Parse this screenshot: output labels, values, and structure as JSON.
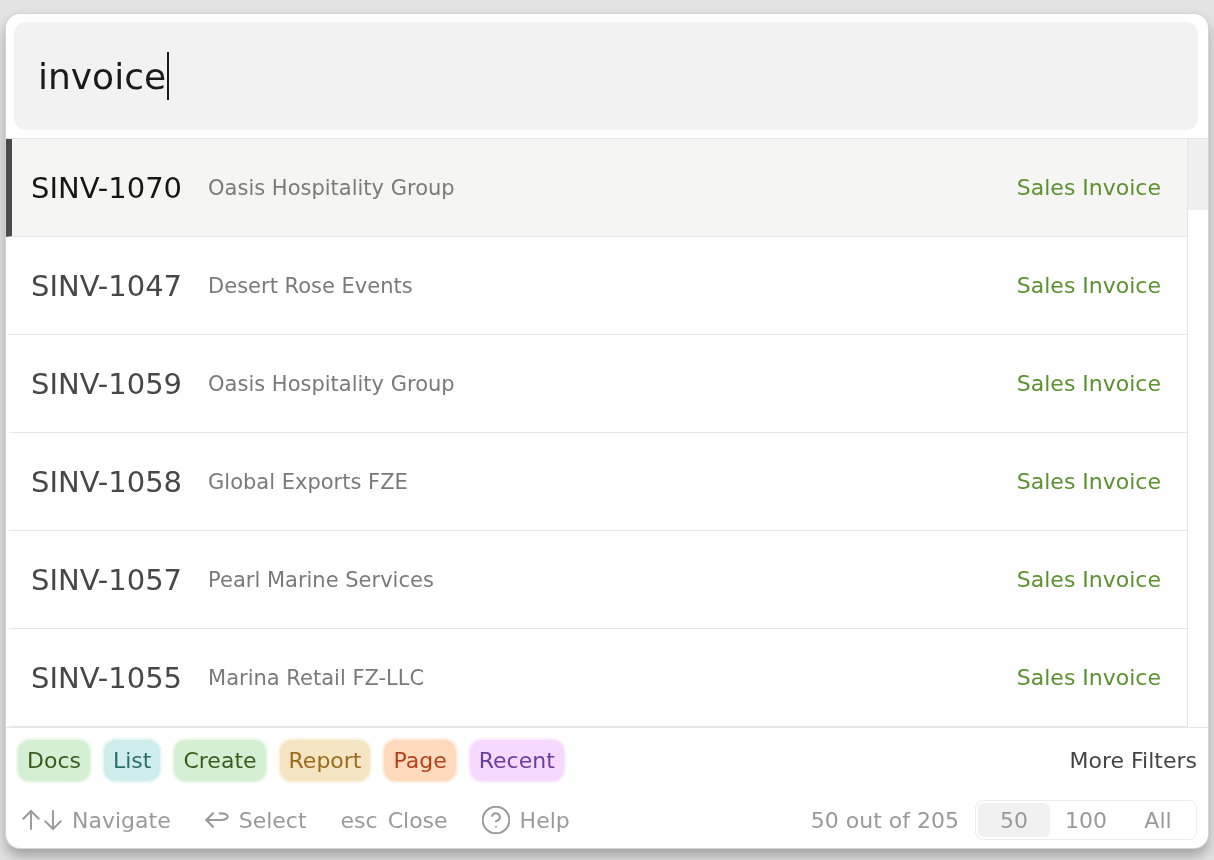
{
  "search": {
    "value": "invoice"
  },
  "results": [
    {
      "id": "SINV-1070",
      "title": "Oasis Hospitality Group",
      "type": "Sales Invoice",
      "selected": true
    },
    {
      "id": "SINV-1047",
      "title": "Desert Rose Events",
      "type": "Sales Invoice",
      "selected": false
    },
    {
      "id": "SINV-1059",
      "title": "Oasis Hospitality Group",
      "type": "Sales Invoice",
      "selected": false
    },
    {
      "id": "SINV-1058",
      "title": "Global Exports FZE",
      "type": "Sales Invoice",
      "selected": false
    },
    {
      "id": "SINV-1057",
      "title": "Pearl Marine Services",
      "type": "Sales Invoice",
      "selected": false
    },
    {
      "id": "SINV-1055",
      "title": "Marina Retail FZ-LLC",
      "type": "Sales Invoice",
      "selected": false
    }
  ],
  "filters": [
    {
      "label": "Docs",
      "color": "#3b5b1c"
    },
    {
      "label": "List",
      "color": "#2c6e69"
    },
    {
      "label": "Create",
      "color": "#3b5b1c"
    },
    {
      "label": "Report",
      "color": "#9c6c1e"
    },
    {
      "label": "Page",
      "color": "#b3431b"
    },
    {
      "label": "Recent",
      "color": "#6a3d9e"
    }
  ],
  "more_filters": "More Filters",
  "hints": [
    {
      "kind": "arrows",
      "label": "Navigate"
    },
    {
      "kind": "enter",
      "label": "Select"
    },
    {
      "kind": "key",
      "key": "esc",
      "label": "Close"
    },
    {
      "kind": "help",
      "label": "Help"
    }
  ],
  "pagination": {
    "count": "50 out of 205",
    "page_sizes": [
      {
        "label": "50",
        "selected": true
      },
      {
        "label": "100",
        "selected": false
      },
      {
        "label": "All",
        "selected": false
      }
    ]
  }
}
